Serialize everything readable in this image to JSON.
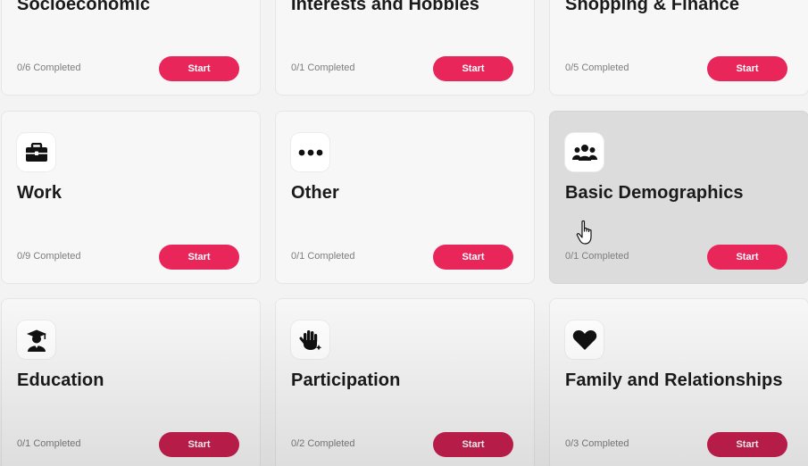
{
  "cards": [
    {
      "title": "Socioeconomic",
      "progress": "0/6 Completed",
      "button": "Start",
      "icon": "none"
    },
    {
      "title": "Interests and Hobbies",
      "progress": "0/1 Completed",
      "button": "Start",
      "icon": "none"
    },
    {
      "title": "Shopping & Finance",
      "progress": "0/5 Completed",
      "button": "Start",
      "icon": "none"
    },
    {
      "title": "Work",
      "progress": "0/9 Completed",
      "button": "Start",
      "icon": "briefcase-icon"
    },
    {
      "title": "Other",
      "progress": "0/1 Completed",
      "button": "Start",
      "icon": "ellipsis-icon"
    },
    {
      "title": "Basic Demographics",
      "progress": "0/1 Completed",
      "button": "Start",
      "icon": "people-group-icon"
    },
    {
      "title": "Education",
      "progress": "0/1 Completed",
      "button": "Start",
      "icon": "graduate-icon"
    },
    {
      "title": "Participation",
      "progress": "0/2 Completed",
      "button": "Start",
      "icon": "raised-hand-icon"
    },
    {
      "title": "Family and Relationships",
      "progress": "0/3 Completed",
      "button": "Start",
      "icon": "heart-icon"
    }
  ],
  "colors": {
    "accent": "#e8265a",
    "card_background": "#f7f7f7",
    "hovered_card_background": "#dcdcdc"
  }
}
